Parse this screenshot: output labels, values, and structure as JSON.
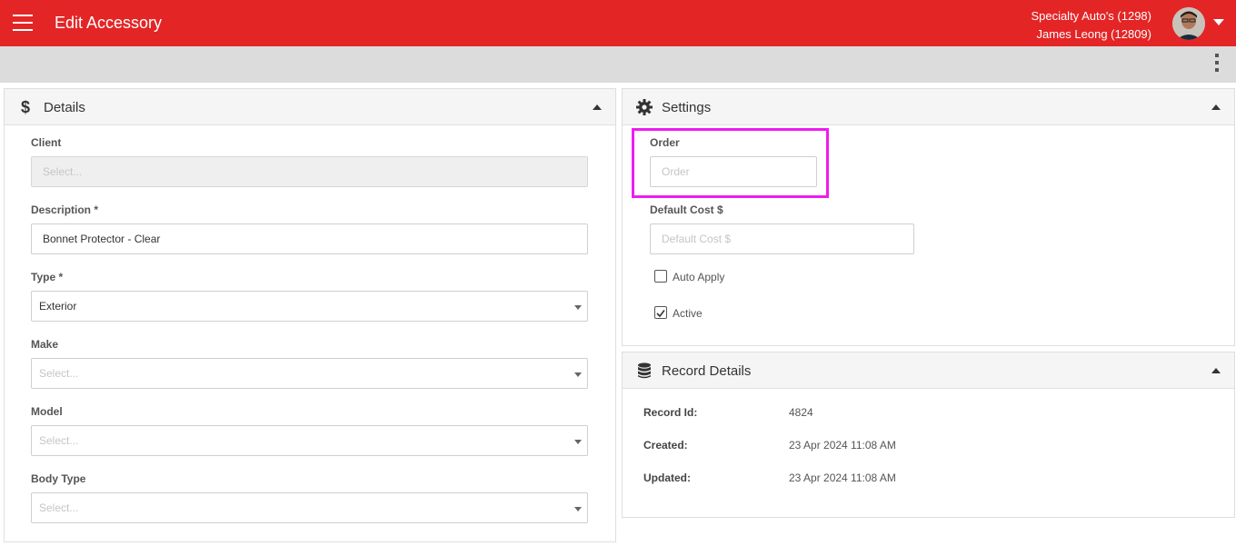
{
  "header": {
    "title": "Edit Accessory",
    "company": "Specialty Auto's (1298)",
    "user": "James Leong (12809)"
  },
  "details_panel": {
    "title": "Details",
    "client": {
      "label": "Client",
      "placeholder": "Select..."
    },
    "description": {
      "label": "Description *",
      "value": "Bonnet Protector - Clear"
    },
    "type": {
      "label": "Type *",
      "value": "Exterior"
    },
    "make": {
      "label": "Make",
      "placeholder": "Select..."
    },
    "model": {
      "label": "Model",
      "placeholder": "Select..."
    },
    "body_type": {
      "label": "Body Type",
      "placeholder": "Select..."
    }
  },
  "settings_panel": {
    "title": "Settings",
    "order": {
      "label": "Order",
      "placeholder": "Order"
    },
    "default_cost": {
      "label": "Default Cost $",
      "placeholder": "Default Cost $"
    },
    "auto_apply": {
      "label": "Auto Apply",
      "checked": false
    },
    "active": {
      "label": "Active",
      "checked": true
    }
  },
  "record_panel": {
    "title": "Record Details",
    "record_id": {
      "label": "Record Id:",
      "value": "4824"
    },
    "created": {
      "label": "Created:",
      "value": "23 Apr 2024 11:08 AM"
    },
    "updated": {
      "label": "Updated:",
      "value": "23 Apr 2024 11:08 AM"
    }
  },
  "colors": {
    "brand": "#e42526",
    "highlight": "#ee1cf0"
  },
  "icons": [
    "menu-icon",
    "dollar-icon",
    "gear-icon",
    "database-icon",
    "more-vertical-icon",
    "chevron-up-icon",
    "caret-down-icon",
    "checkmark-icon"
  ]
}
